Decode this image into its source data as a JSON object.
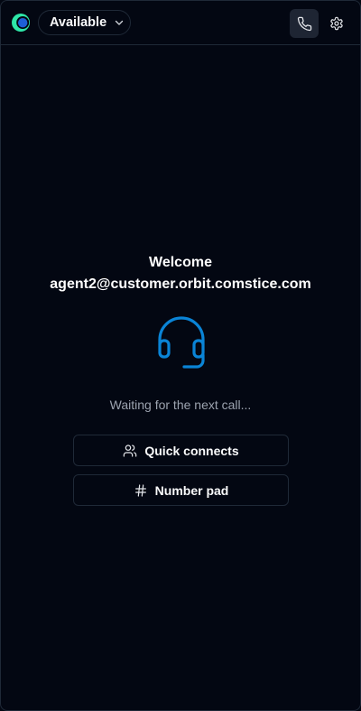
{
  "header": {
    "status_label": "Available"
  },
  "welcome": {
    "title": "Welcome",
    "email": "agent2@customer.orbit.comstice.com"
  },
  "status_message": "Waiting for the next call...",
  "actions": {
    "quick_connects": "Quick connects",
    "number_pad": "Number pad"
  },
  "icons": {
    "logo": "app-logo",
    "status_chevron": "chevron-down-icon",
    "phone": "phone-icon",
    "settings": "gear-icon",
    "headset": "headset-icon",
    "quick_connects": "users-icon",
    "number_pad": "hash-icon"
  },
  "colors": {
    "background": "#030712",
    "border": "#1f2937",
    "accent": "#0a84d6",
    "text_primary": "#f9fafb",
    "text_muted": "#9ca3af"
  }
}
